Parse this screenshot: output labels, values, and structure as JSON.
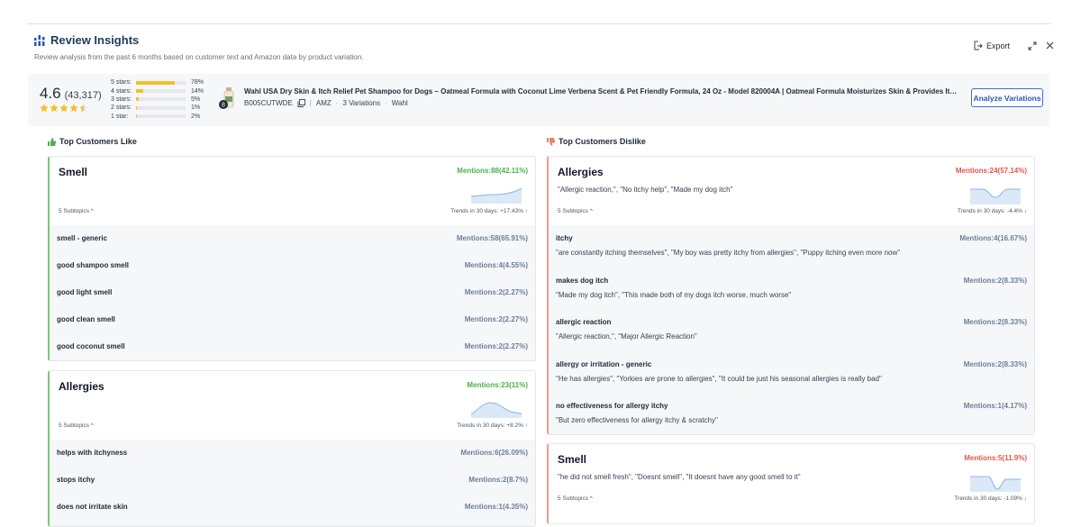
{
  "header": {
    "title": "Review Insights",
    "subtitle": "Review analysis from the past 6 months based on customer text and Amazon data by product variation.",
    "export_label": "Export"
  },
  "summary": {
    "score": "4.6",
    "count": "(43,317)",
    "star_fill": 4.5,
    "distribution": [
      {
        "label": "5 stars:",
        "pct": "78%",
        "value": 78
      },
      {
        "label": "4 stars:",
        "pct": "14%",
        "value": 14
      },
      {
        "label": "3 stars:",
        "pct": "5%",
        "value": 5
      },
      {
        "label": "2 stars:",
        "pct": "1%",
        "value": 1
      },
      {
        "label": "1 star:",
        "pct": "2%",
        "value": 2
      }
    ],
    "product": {
      "title": "Wahl USA Dry Skin & Itch Relief Pet Shampoo for Dogs – Oatmeal Formula with Coconut Lime Verbena Scent & Pet Friendly Formula, 24 Oz - Model 820004A | Oatmeal Formula Moisturizes Skin & Provides Itch...",
      "asin": "B005CUTWDE",
      "market": "AMZ",
      "variations": "3 Variations",
      "brand": "Wahl",
      "badge": "8"
    },
    "analyze_label": "Analyze Variations"
  },
  "likes": {
    "heading": "Top Customers Like",
    "cards": [
      {
        "name": "Smell",
        "mentions": "Mentions:88(42.11%)",
        "subtopics": "5 Subtopics ^",
        "trend": "Trends in 30 days: +17.43% ↑",
        "rows": [
          {
            "name": "smell - generic",
            "mentions": "Mentions:58(65.91%)"
          },
          {
            "name": "good shampoo smell",
            "mentions": "Mentions:4(4.55%)"
          },
          {
            "name": "good light smell",
            "mentions": "Mentions:2(2.27%)"
          },
          {
            "name": "good clean smell",
            "mentions": "Mentions:2(2.27%)"
          },
          {
            "name": "good coconut smell",
            "mentions": "Mentions:2(2.27%)"
          }
        ]
      },
      {
        "name": "Allergies",
        "mentions": "Mentions:23(11%)",
        "subtopics": "5 Subtopics ^",
        "trend": "Trends in 30 days: +8.2% ↑",
        "rows": [
          {
            "name": "helps with itchyness",
            "mentions": "Mentions:6(26.09%)"
          },
          {
            "name": "stops itchy",
            "mentions": "Mentions:2(8.7%)"
          },
          {
            "name": "does not irritate skin",
            "mentions": "Mentions:1(4.35%)"
          }
        ]
      }
    ]
  },
  "dislikes": {
    "heading": "Top Customers Dislike",
    "cards": [
      {
        "name": "Allergies",
        "mentions": "Mentions:24(57.14%)",
        "quotes": "\"Allergic reaction,\", \"No itchy help\", \"Made my dog itch\"",
        "subtopics": "5 Subtopics ^",
        "trend": "Trends in 30 days: -4.4% ↓",
        "rows": [
          {
            "name": "itchy",
            "mentions": "Mentions:4(16.67%)",
            "quotes": "\"are constantly itching themselves\", \"My boy was pretty itchy from allergies\", \"Puppy itching even more now\""
          },
          {
            "name": "makes dog itch",
            "mentions": "Mentions:2(8.33%)",
            "quotes": "\"Made my dog itch\", \"This made both of my dogs itch worse, much worse\""
          },
          {
            "name": "allergic reaction",
            "mentions": "Mentions:2(8.33%)",
            "quotes": "\"Allergic reaction,\", \"Major Allergic Reaction\""
          },
          {
            "name": "allergy or irritation - generic",
            "mentions": "Mentions:2(8.33%)",
            "quotes": "\"He has allergies\", \"Yorkies are prone to allergies\", \"It could be just his seasonal allergies is really bad\""
          },
          {
            "name": "no effectiveness for allergy itchy",
            "mentions": "Mentions:1(4.17%)",
            "quotes": "\"But zero effectiveness for allergy itchy & scratchy\""
          }
        ]
      },
      {
        "name": "Smell",
        "mentions": "Mentions:5(11.9%)",
        "quotes": "\"he did not smell fresh\", \"Doesnt smell\", \"It doesnt have any good smell to it\"",
        "subtopics": "5 Subtopics ^",
        "trend": "Trends in 30 days: -1.09% ↓",
        "rows": []
      }
    ]
  },
  "colors": {
    "like_accent": "#4caf50",
    "dislike_accent": "#e0574a",
    "star": "#f2c02c",
    "brand": "#1e3a5f"
  }
}
